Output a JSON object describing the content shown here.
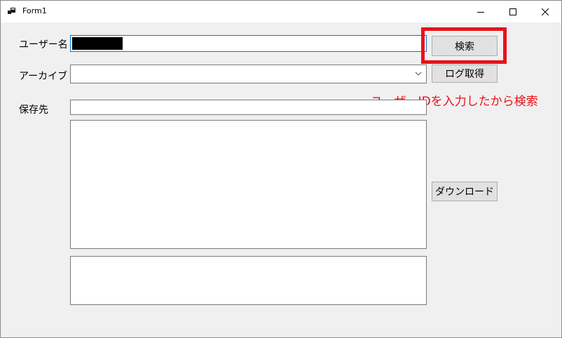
{
  "window": {
    "title": "Form1",
    "controls": [
      "minimize-icon",
      "maximize-icon",
      "close-icon"
    ]
  },
  "form": {
    "username_label": "ユーザー名",
    "username_value": "",
    "search_button": "検索",
    "archive_label": "アーカイブ",
    "archive_selected": "",
    "get_log_button": "ログ取得",
    "save_to_label": "保存先",
    "save_to_value": "",
    "download_button": "ダウンロード",
    "main_textarea_value": "",
    "lower_textarea_value": ""
  },
  "annotation": {
    "text": "ユーザーIDを入力したから検索",
    "color": "#e8121a"
  }
}
